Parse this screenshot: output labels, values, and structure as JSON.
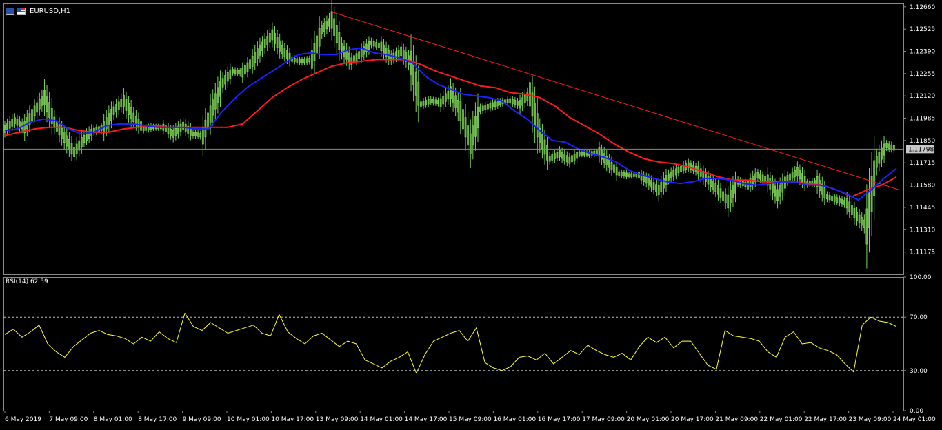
{
  "window": {
    "symbol": "EURUSD,H1"
  },
  "colors": {
    "background": "#000000",
    "bull_candle": "#00ff00",
    "price_candle": "#7fd35a",
    "ma_fast": "#1a22ff",
    "ma_slow": "#ff1a1a",
    "trendline": "#ff1a1a",
    "rsi_line": "#ffff3a",
    "grid": "#8a8a8a",
    "current_price_box": "#c8c8c8"
  },
  "chart_data": [
    {
      "type": "line",
      "title": "EURUSD,H1",
      "current_price": "1.11798",
      "y_ticks": [
        "1.12660",
        "1.12525",
        "1.12390",
        "1.12255",
        "1.12120",
        "1.11985",
        "1.11850",
        "1.11715",
        "1.11580",
        "1.11445",
        "1.11310",
        "1.11175"
      ],
      "ylim": [
        1.1104,
        1.1268
      ],
      "x_tick_labels": [
        "6 May 2019",
        "7 May 09:00",
        "8 May 01:00",
        "8 May 17:00",
        "9 May 09:00",
        "10 May 01:00",
        "10 May 17:00",
        "13 May 09:00",
        "14 May 01:00",
        "14 May 17:00",
        "15 May 09:00",
        "16 May 01:00",
        "16 May 17:00",
        "17 May 09:00",
        "20 May 01:00",
        "20 May 17:00",
        "21 May 09:00",
        "22 May 01:00",
        "22 May 17:00",
        "23 May 09:00",
        "24 May 01:00"
      ],
      "series": [
        {
          "kind": "price",
          "values": [
            1.1192,
            1.1197,
            1.1193,
            1.1203,
            1.1211,
            1.1196,
            1.1187,
            1.1178,
            1.1186,
            1.1191,
            1.1193,
            1.1203,
            1.1209,
            1.1199,
            1.1192,
            1.1193,
            1.1193,
            1.1189,
            1.1194,
            1.1189,
            1.1188,
            1.1205,
            1.122,
            1.1227,
            1.1226,
            1.1233,
            1.1242,
            1.1249,
            1.124,
            1.1234,
            1.1233,
            1.1234,
            1.1252,
            1.1258,
            1.1241,
            1.1233,
            1.1238,
            1.1244,
            1.1242,
            1.1235,
            1.1239,
            1.1232,
            1.1207,
            1.1209,
            1.1208,
            1.1214,
            1.1203,
            1.1183,
            1.1204,
            1.1206,
            1.1208,
            1.1209,
            1.1207,
            1.1213,
            1.1188,
            1.1174,
            1.1177,
            1.1173,
            1.1177,
            1.1177,
            1.1178,
            1.1171,
            1.1165,
            1.1164,
            1.1164,
            1.116,
            1.1155,
            1.1163,
            1.1167,
            1.117,
            1.1167,
            1.1161,
            1.1155,
            1.1148,
            1.116,
            1.1158,
            1.1164,
            1.1161,
            1.1152,
            1.1162,
            1.1166,
            1.1159,
            1.116,
            1.1151,
            1.1149,
            1.1147,
            1.1139,
            1.1133,
            1.1172,
            1.1182,
            1.118
          ]
        },
        {
          "kind": "moving_average",
          "values": [
            1.1191,
            1.1192,
            1.1196,
            1.1198,
            1.1197,
            1.1192,
            1.1189,
            1.119,
            1.1194,
            1.1195,
            1.1195,
            1.1194,
            1.1193,
            1.1193,
            1.1193,
            1.1192,
            1.1192,
            1.1202,
            1.121,
            1.1217,
            1.1222,
            1.1227,
            1.1232,
            1.1237,
            1.1238,
            1.1237,
            1.1237,
            1.124,
            1.1241,
            1.1238,
            1.1237,
            1.1235,
            1.1232,
            1.1224,
            1.1219,
            1.1216,
            1.1213,
            1.1212,
            1.1211,
            1.1209,
            1.1203,
            1.1198,
            1.1191,
            1.1185,
            1.1184,
            1.118,
            1.1177,
            1.1175,
            1.1172,
            1.1167,
            1.1164,
            1.1162,
            1.116,
            1.1159,
            1.116,
            1.1162,
            1.1162,
            1.1161,
            1.1159,
            1.1158,
            1.1159,
            1.116,
            1.116,
            1.1158,
            1.1158,
            1.1156,
            1.1153,
            1.1149,
            1.1155,
            1.1162,
            1.1168
          ]
        },
        {
          "kind": "moving_average",
          "values": [
            1.1188,
            1.119,
            1.1192,
            1.1193,
            1.1193,
            1.1191,
            1.119,
            1.119,
            1.1192,
            1.1193,
            1.1194,
            1.1193,
            1.1193,
            1.1193,
            1.1193,
            1.1193,
            1.1195,
            1.1203,
            1.1211,
            1.1217,
            1.1222,
            1.1226,
            1.123,
            1.1232,
            1.1233,
            1.1234,
            1.1234,
            1.1234,
            1.1231,
            1.1227,
            1.1224,
            1.1221,
            1.1218,
            1.1217,
            1.1214,
            1.1213,
            1.1211,
            1.1206,
            1.1199,
            1.1194,
            1.1189,
            1.1183,
            1.1178,
            1.1174,
            1.1172,
            1.1171,
            1.1169,
            1.1166,
            1.1163,
            1.1161,
            1.1161,
            1.116,
            1.116,
            1.116,
            1.1159,
            1.1158,
            1.1155,
            1.1151,
            1.1155,
            1.1158,
            1.1163
          ]
        },
        {
          "kind": "trendline",
          "values": [
            1.1263,
            1.1155
          ]
        }
      ]
    },
    {
      "type": "line",
      "title": "RSI(14) 62.59",
      "y_ticks": [
        "100.00",
        "70.00",
        "30.00",
        "0.00"
      ],
      "ylim": [
        0,
        100
      ],
      "levels": [
        70,
        30
      ],
      "series": [
        {
          "name": "RSI(14)",
          "values": [
            57,
            61,
            55,
            59,
            64,
            50,
            44,
            40,
            48,
            53,
            58,
            60,
            57,
            56,
            54,
            50,
            55,
            52,
            59,
            54,
            51,
            73,
            63,
            60,
            66,
            62,
            58,
            60,
            62,
            64,
            58,
            56,
            72,
            59,
            54,
            50,
            56,
            58,
            53,
            48,
            52,
            50,
            38,
            35,
            32,
            37,
            40,
            44,
            28,
            42,
            52,
            55,
            58,
            60,
            52,
            62,
            36,
            32,
            30,
            33,
            40,
            41,
            38,
            43,
            35,
            40,
            45,
            42,
            49,
            45,
            42,
            40,
            43,
            38,
            48,
            55,
            51,
            55,
            47,
            52,
            52,
            43,
            34,
            31,
            60,
            56,
            55,
            54,
            52,
            44,
            40,
            55,
            59,
            50,
            51,
            47,
            45,
            42,
            35,
            29,
            64,
            70,
            67,
            66,
            63
          ]
        }
      ]
    }
  ]
}
